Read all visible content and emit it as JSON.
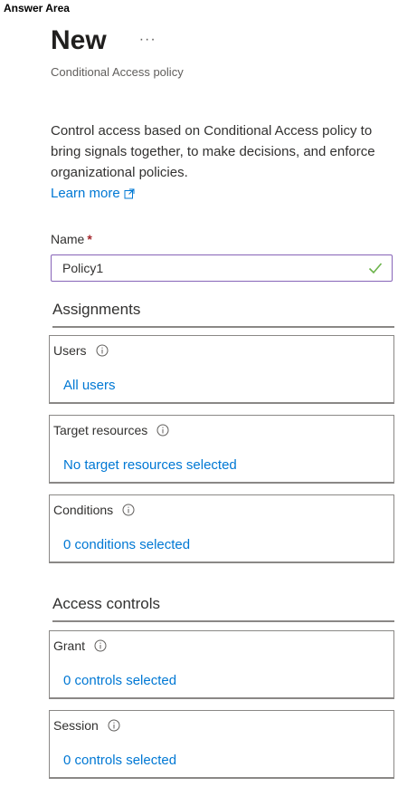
{
  "answer_area": "Answer Area",
  "header": {
    "title": "New",
    "more": "···",
    "subtitle": "Conditional Access policy"
  },
  "description": "Control access based on Conditional Access policy to bring signals together, to make decisions, and enforce organizational policies.",
  "learn_more": "Learn more",
  "name_field": {
    "label": "Name",
    "required": "*",
    "value": "Policy1"
  },
  "assignments": {
    "heading": "Assignments",
    "users": {
      "label": "Users",
      "link": "All users"
    },
    "target_resources": {
      "label": "Target resources",
      "link": "No target resources selected"
    },
    "conditions": {
      "label": "Conditions",
      "link": "0 conditions selected"
    }
  },
  "access_controls": {
    "heading": "Access controls",
    "grant": {
      "label": "Grant",
      "link": "0 controls selected"
    },
    "session": {
      "label": "Session",
      "link": "0 controls selected"
    }
  },
  "colors": {
    "link": "#0078d4",
    "input_border": "#8764b8",
    "check": "#107c10",
    "required": "#a4262c"
  },
  "icons": [
    "more-icon",
    "external-link-icon",
    "check-icon",
    "info-icon"
  ]
}
